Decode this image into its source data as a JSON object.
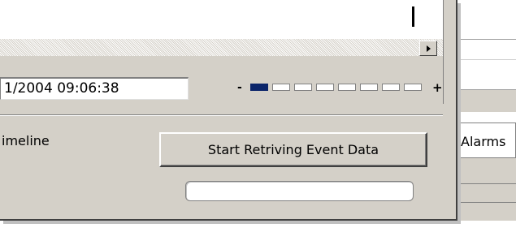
{
  "dialog": {
    "datetime_value": "1/2004 09:06:38",
    "zoom": {
      "minus_label": "-",
      "plus_label": "+",
      "segments_total": 8,
      "segments_active": 1
    },
    "timeline_label": "imeline",
    "start_button_label": "Start Retriving Event Data",
    "progress": 0
  },
  "background": {
    "alarms_tab_label": "Alarms"
  },
  "colors": {
    "face": "#d4d0c8",
    "zoom_active": "#0a246a"
  },
  "icons": {
    "scroll_right": "scroll-right-arrow-icon"
  }
}
